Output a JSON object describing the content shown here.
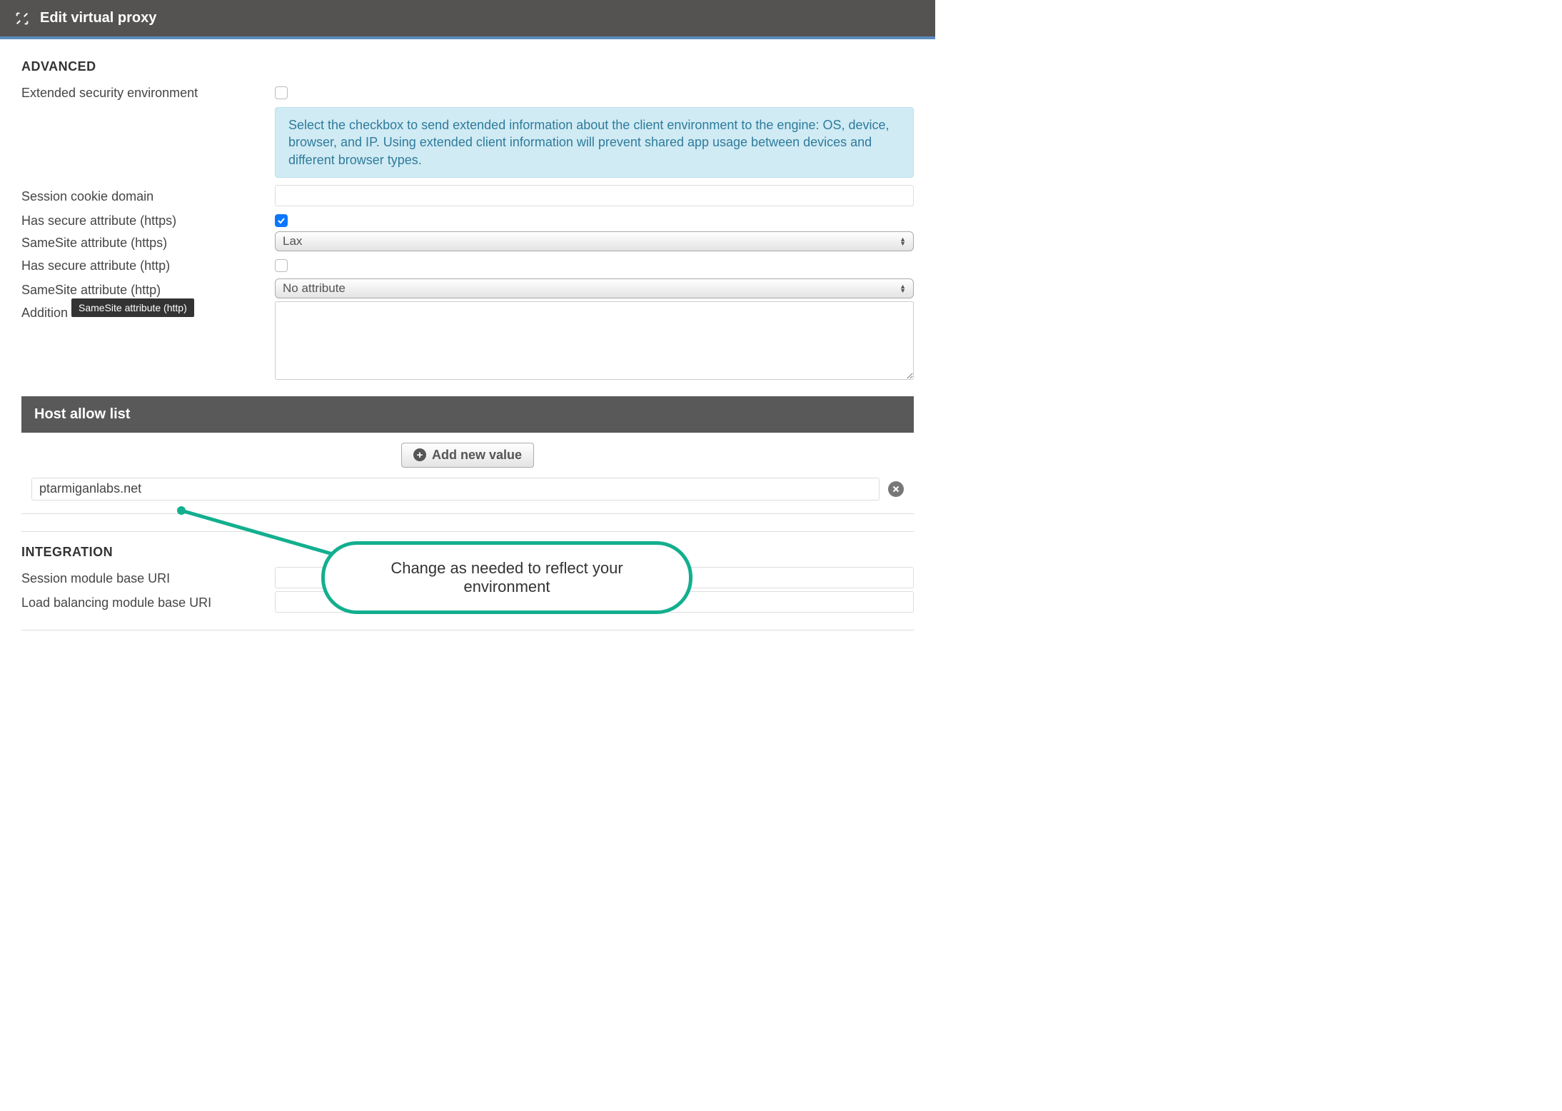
{
  "header": {
    "title": "Edit virtual proxy"
  },
  "sections": {
    "advanced": {
      "title": "ADVANCED",
      "ext_sec_label": "Extended security environment",
      "ext_sec_info": "Select the checkbox to send extended information about the client environment to the engine: OS, device, browser, and IP. Using extended client information will prevent shared app usage between devices and different browser types.",
      "session_cookie_domain_label": "Session cookie domain",
      "session_cookie_domain_value": "",
      "has_secure_https_label": "Has secure attribute (https)",
      "samesite_https_label": "SameSite attribute (https)",
      "samesite_https_value": "Lax",
      "has_secure_http_label": "Has secure attribute (http)",
      "samesite_http_label": "SameSite attribute (http)",
      "samesite_http_value": "No attribute",
      "additional_label": "Addition",
      "additional_value": "",
      "tooltip_text": "SameSite attribute (http)"
    },
    "hostallow": {
      "title": "Host allow list",
      "add_button": "Add new value",
      "items": [
        {
          "value": "ptarmiganlabs.net"
        }
      ]
    },
    "integration": {
      "title": "INTEGRATION",
      "session_module_label": "Session module base URI",
      "session_module_value": "",
      "lb_module_label": "Load balancing module base URI",
      "lb_module_value": ""
    }
  },
  "annotation": {
    "text_line1": "Change as needed to reflect your",
    "text_line2": "environment"
  }
}
